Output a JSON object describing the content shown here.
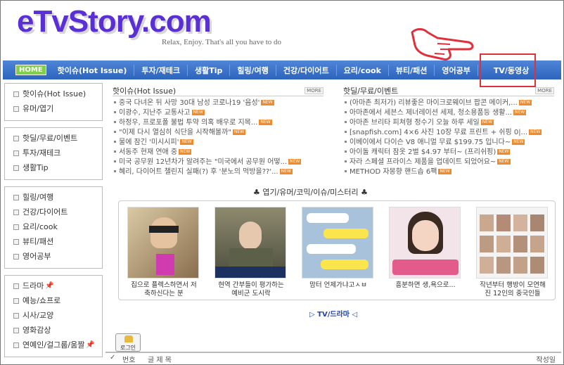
{
  "site": {
    "logo": "eTvStory.com",
    "tagline": "Relax, Enjoy. That's all you have to do"
  },
  "nav": {
    "home": "HOME",
    "items": [
      "핫이슈(Hot Issue)",
      "투자/재테크",
      "생활Tip",
      "힐링/여행",
      "건강/다이어트",
      "요리/cook",
      "뷰티/패션",
      "영어공부",
      "TV/동영상"
    ]
  },
  "sidebar": {
    "groups": [
      [
        "핫이슈(Hot Issue)",
        "유머/엽기"
      ],
      [
        "핫딜/무료/이벤트",
        "투자/재테크",
        "생활Tip"
      ],
      [
        "힐링/여행",
        "건강/다이어트",
        "요리/cook",
        "뷰티/패션",
        "영어공부"
      ],
      [
        "드라마",
        "예능/쇼프로",
        "시사/교양",
        "영화감상",
        "연예인/걸그룹/움짤"
      ]
    ]
  },
  "news_left": {
    "title": "핫이슈(Hot Issue)",
    "more": "MORE",
    "items": [
      "중국 다녀온 뒤 사망 30대 남성 코로나19 '음성'",
      "이광수, 지난주 교통사고",
      "하정우, 프로포폴 불법 투약 의혹 배우로 지목...",
      "\"이제 다시 열심히 식단을 시작해볼까\"",
      "물에 잠긴 '미시시피'",
      "서동주 현재 연애 중",
      "미국 공무원 12년차가 알려주는 \"미국에서 공무원 어떻...",
      "혜리, 다이어트 챌린지 실패(?) 후 '분노의 먹방을??'..."
    ]
  },
  "news_right": {
    "title": "핫딜/무료/이벤트",
    "more": "MORE",
    "items": [
      "(아마존 최저가) 리뷰좋은 마이크로웨이브 팝콘 메이커,...",
      "아마존에서 세븐스 제너레이션 세제, 청소용품등 생활...",
      "아마존 브리타 피쳐형 정수기 오늘 하루 세일",
      "[snapfish.com] 4×6 사진 10장 무료 프린트 + 쉬핑 0|...",
      "이베이에서 다이슨 V8 애니멀 무료 $199.75 입니다~",
      "아이돌 캐릭터 잠옷 2벌 $4.97 부터~ (프리쉬핑)",
      "자라 스페셜 프라이스 제품을 업데이트 되었어요~",
      "METHOD 자몽향 핸드솝 6팩"
    ]
  },
  "badge_new": "NEW",
  "section": {
    "title": "♣ 엽기/유머/코믹/이슈/미스터리 ♣"
  },
  "gallery": [
    {
      "caption": "집으로 플렉스하면서 저 축하신다는 분"
    },
    {
      "caption": "현역 간부들이 평가하는 예비군 도시락"
    },
    {
      "caption": "맘터 언제가냐고ㅅㅂ"
    },
    {
      "caption": "흥분하면 생,욕으로..."
    },
    {
      "caption": "작년부터 행방이 모연해 진 12인의 중국인들"
    }
  ],
  "tvlink": "▷ TV/드라마 ◁",
  "login": "로그인",
  "board": {
    "check": "✓",
    "number": "번호",
    "title": "글 제 목",
    "writer": "작성일"
  },
  "colors": {
    "nav": "#3a72cc",
    "logo": "#5b2fd6",
    "highlight": "#e0303a",
    "badge": "#f08a2b"
  }
}
